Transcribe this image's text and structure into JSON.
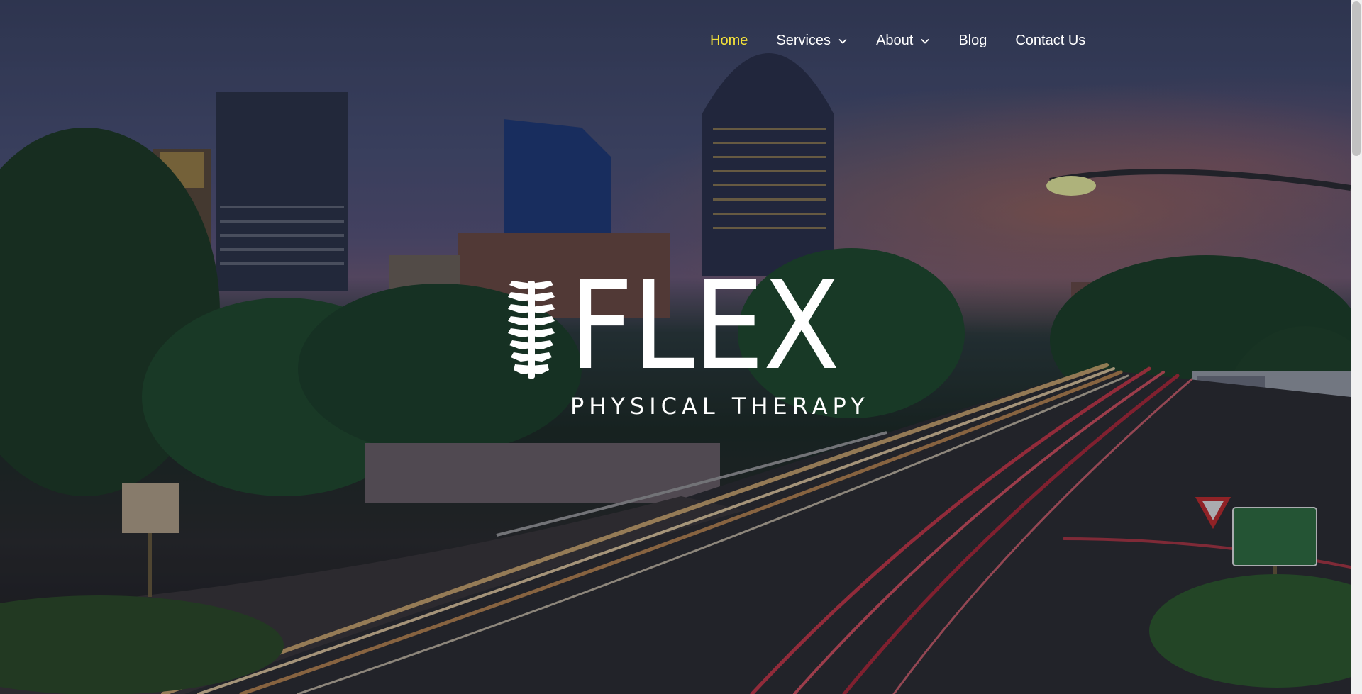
{
  "nav": {
    "items": [
      {
        "label": "Home",
        "active": true,
        "has_dropdown": false
      },
      {
        "label": "Services",
        "active": false,
        "has_dropdown": true
      },
      {
        "label": "About",
        "active": false,
        "has_dropdown": true
      },
      {
        "label": "Blog",
        "active": false,
        "has_dropdown": false
      },
      {
        "label": "Contact Us",
        "active": false,
        "has_dropdown": false
      }
    ]
  },
  "logo": {
    "word": "FLEX",
    "tagline": "PHYSICAL THERAPY",
    "icon": "spine-icon"
  },
  "colors": {
    "nav_active": "#f4e23a",
    "nav_text": "#ffffff",
    "logo": "#ffffff"
  }
}
